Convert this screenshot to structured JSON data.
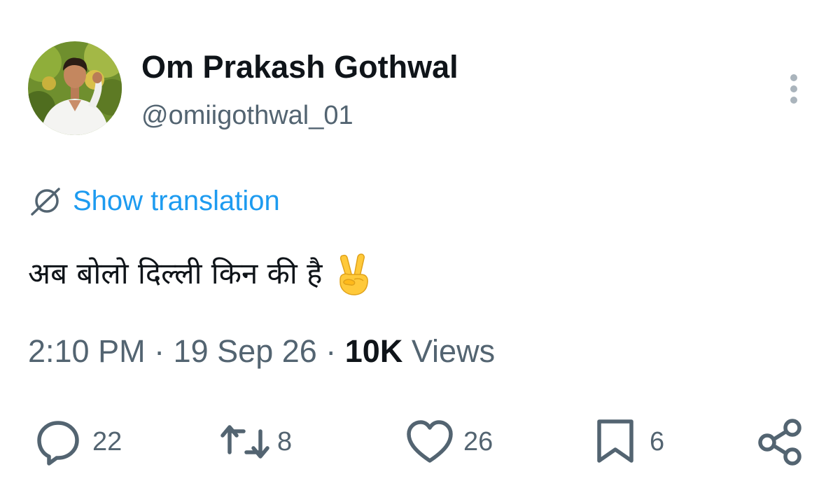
{
  "author": {
    "display_name": "Om Prakash Gothwal",
    "handle": "@omiigothwal_01",
    "avatar_icon": "profile-photo"
  },
  "translation": {
    "label": "Show translation",
    "icon": "globe-icon",
    "color": "#1d9bf0"
  },
  "tweet": {
    "text": "अब बोलो दिल्ली किन की है",
    "emoji": "victory-hand-emoji"
  },
  "meta": {
    "time": "2:10 PM",
    "separator": " · ",
    "date": "19 Sep 26",
    "views_count": "10K",
    "views_label": " Views"
  },
  "actions": {
    "replies": "22",
    "reposts": "8",
    "likes": "26",
    "bookmarks": "6"
  },
  "colors": {
    "primary_text": "#0f1419",
    "secondary_text": "#536471",
    "accent": "#1d9bf0"
  }
}
